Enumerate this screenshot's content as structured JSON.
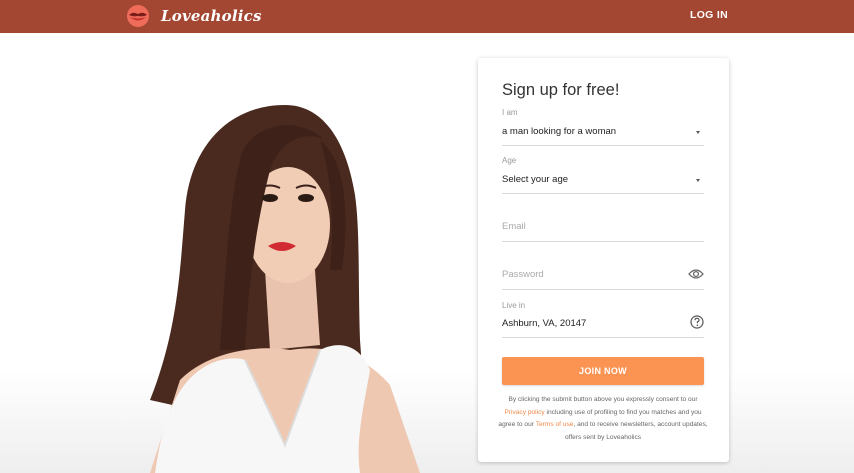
{
  "header": {
    "brand_name": "Loveaholics",
    "login_label": "LOG IN",
    "bg_color": "#a34733",
    "logo_icon": "heart-lips-icon"
  },
  "hero": {
    "image": "woman-portrait-photo"
  },
  "signup": {
    "title": "Sign up for free!",
    "i_am": {
      "label": "I am",
      "value": "a man looking for a woman"
    },
    "age": {
      "label": "Age",
      "value": "Select your age"
    },
    "email": {
      "placeholder": "Email"
    },
    "password": {
      "placeholder": "Password",
      "icon": "eye-icon"
    },
    "live_in": {
      "label": "Live in",
      "value": "Ashburn, VA, 20147",
      "icon": "question-circle-icon"
    },
    "join_label": "JOIN NOW",
    "join_color": "#fb9452",
    "legal": {
      "p1": "By clicking the submit button above you expressly consent to our ",
      "privacy_link": "Privacy policy",
      "p2": " including use of profiling to find you matches and you agree to our ",
      "terms_link": "Terms of use",
      "p3": ", and to receive newsletters, account updates, offers sent by Loveaholics"
    }
  }
}
